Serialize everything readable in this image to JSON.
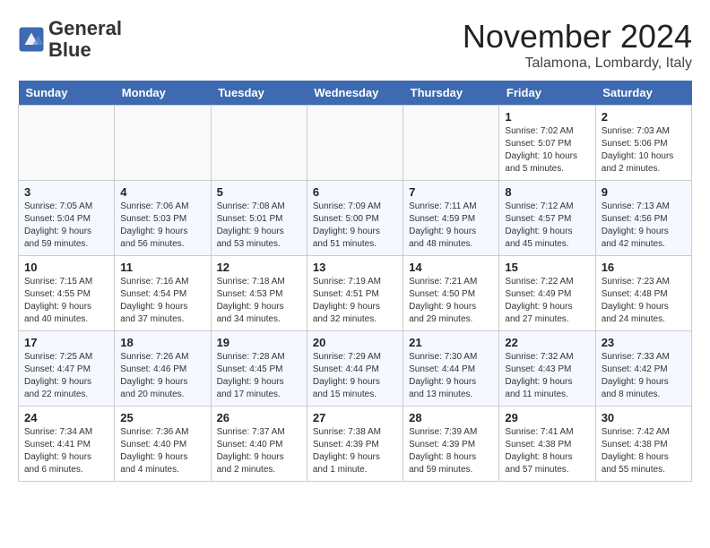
{
  "logo": {
    "line1": "General",
    "line2": "Blue"
  },
  "title": "November 2024",
  "subtitle": "Talamona, Lombardy, Italy",
  "days_of_week": [
    "Sunday",
    "Monday",
    "Tuesday",
    "Wednesday",
    "Thursday",
    "Friday",
    "Saturday"
  ],
  "weeks": [
    [
      {
        "day": null
      },
      {
        "day": null
      },
      {
        "day": null
      },
      {
        "day": null
      },
      {
        "day": null
      },
      {
        "day": 1,
        "sunrise": "7:02 AM",
        "sunset": "5:07 PM",
        "daylight": "10 hours and 5 minutes."
      },
      {
        "day": 2,
        "sunrise": "7:03 AM",
        "sunset": "5:06 PM",
        "daylight": "10 hours and 2 minutes."
      }
    ],
    [
      {
        "day": 3,
        "sunrise": "7:05 AM",
        "sunset": "5:04 PM",
        "daylight": "9 hours and 59 minutes."
      },
      {
        "day": 4,
        "sunrise": "7:06 AM",
        "sunset": "5:03 PM",
        "daylight": "9 hours and 56 minutes."
      },
      {
        "day": 5,
        "sunrise": "7:08 AM",
        "sunset": "5:01 PM",
        "daylight": "9 hours and 53 minutes."
      },
      {
        "day": 6,
        "sunrise": "7:09 AM",
        "sunset": "5:00 PM",
        "daylight": "9 hours and 51 minutes."
      },
      {
        "day": 7,
        "sunrise": "7:11 AM",
        "sunset": "4:59 PM",
        "daylight": "9 hours and 48 minutes."
      },
      {
        "day": 8,
        "sunrise": "7:12 AM",
        "sunset": "4:57 PM",
        "daylight": "9 hours and 45 minutes."
      },
      {
        "day": 9,
        "sunrise": "7:13 AM",
        "sunset": "4:56 PM",
        "daylight": "9 hours and 42 minutes."
      }
    ],
    [
      {
        "day": 10,
        "sunrise": "7:15 AM",
        "sunset": "4:55 PM",
        "daylight": "9 hours and 40 minutes."
      },
      {
        "day": 11,
        "sunrise": "7:16 AM",
        "sunset": "4:54 PM",
        "daylight": "9 hours and 37 minutes."
      },
      {
        "day": 12,
        "sunrise": "7:18 AM",
        "sunset": "4:53 PM",
        "daylight": "9 hours and 34 minutes."
      },
      {
        "day": 13,
        "sunrise": "7:19 AM",
        "sunset": "4:51 PM",
        "daylight": "9 hours and 32 minutes."
      },
      {
        "day": 14,
        "sunrise": "7:21 AM",
        "sunset": "4:50 PM",
        "daylight": "9 hours and 29 minutes."
      },
      {
        "day": 15,
        "sunrise": "7:22 AM",
        "sunset": "4:49 PM",
        "daylight": "9 hours and 27 minutes."
      },
      {
        "day": 16,
        "sunrise": "7:23 AM",
        "sunset": "4:48 PM",
        "daylight": "9 hours and 24 minutes."
      }
    ],
    [
      {
        "day": 17,
        "sunrise": "7:25 AM",
        "sunset": "4:47 PM",
        "daylight": "9 hours and 22 minutes."
      },
      {
        "day": 18,
        "sunrise": "7:26 AM",
        "sunset": "4:46 PM",
        "daylight": "9 hours and 20 minutes."
      },
      {
        "day": 19,
        "sunrise": "7:28 AM",
        "sunset": "4:45 PM",
        "daylight": "9 hours and 17 minutes."
      },
      {
        "day": 20,
        "sunrise": "7:29 AM",
        "sunset": "4:44 PM",
        "daylight": "9 hours and 15 minutes."
      },
      {
        "day": 21,
        "sunrise": "7:30 AM",
        "sunset": "4:44 PM",
        "daylight": "9 hours and 13 minutes."
      },
      {
        "day": 22,
        "sunrise": "7:32 AM",
        "sunset": "4:43 PM",
        "daylight": "9 hours and 11 minutes."
      },
      {
        "day": 23,
        "sunrise": "7:33 AM",
        "sunset": "4:42 PM",
        "daylight": "9 hours and 8 minutes."
      }
    ],
    [
      {
        "day": 24,
        "sunrise": "7:34 AM",
        "sunset": "4:41 PM",
        "daylight": "9 hours and 6 minutes."
      },
      {
        "day": 25,
        "sunrise": "7:36 AM",
        "sunset": "4:40 PM",
        "daylight": "9 hours and 4 minutes."
      },
      {
        "day": 26,
        "sunrise": "7:37 AM",
        "sunset": "4:40 PM",
        "daylight": "9 hours and 2 minutes."
      },
      {
        "day": 27,
        "sunrise": "7:38 AM",
        "sunset": "4:39 PM",
        "daylight": "9 hours and 1 minute."
      },
      {
        "day": 28,
        "sunrise": "7:39 AM",
        "sunset": "4:39 PM",
        "daylight": "8 hours and 59 minutes."
      },
      {
        "day": 29,
        "sunrise": "7:41 AM",
        "sunset": "4:38 PM",
        "daylight": "8 hours and 57 minutes."
      },
      {
        "day": 30,
        "sunrise": "7:42 AM",
        "sunset": "4:38 PM",
        "daylight": "8 hours and 55 minutes."
      }
    ]
  ]
}
